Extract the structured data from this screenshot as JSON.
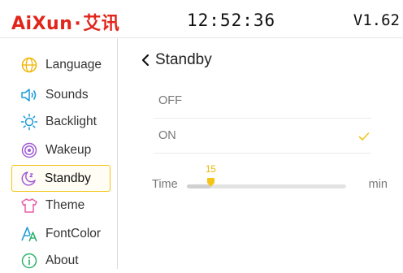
{
  "header": {
    "brand_latin": "AiXun",
    "brand_sep": "·",
    "brand_cn": "艾讯",
    "clock": "12:52:36",
    "version": "V1.62"
  },
  "sidebar": {
    "items": [
      {
        "label": "Language",
        "icon": "globe-icon"
      },
      {
        "label": "Sounds",
        "icon": "speaker-icon"
      },
      {
        "label": "Backlight",
        "icon": "sun-icon"
      },
      {
        "label": "Wakeup",
        "icon": "target-icon"
      },
      {
        "label": "Standby",
        "icon": "moon-icon",
        "active": true
      },
      {
        "label": "Theme",
        "icon": "shirt-icon"
      },
      {
        "label": "FontColor",
        "icon": "font-icon"
      },
      {
        "label": "About",
        "icon": "info-icon"
      }
    ]
  },
  "main": {
    "title": "Standby",
    "options": [
      {
        "label": "OFF",
        "selected": false
      },
      {
        "label": "ON",
        "selected": true
      }
    ],
    "time": {
      "label": "Time",
      "unit": "min",
      "value": "15",
      "slider_fraction": 0.15
    }
  },
  "colors": {
    "brand": "#e1251b",
    "accent": "#f4c518",
    "icon_blue": "#1a9ad9",
    "icon_purple": "#a15cd6",
    "icon_pink": "#e85ca7",
    "icon_green": "#2bb26b"
  }
}
